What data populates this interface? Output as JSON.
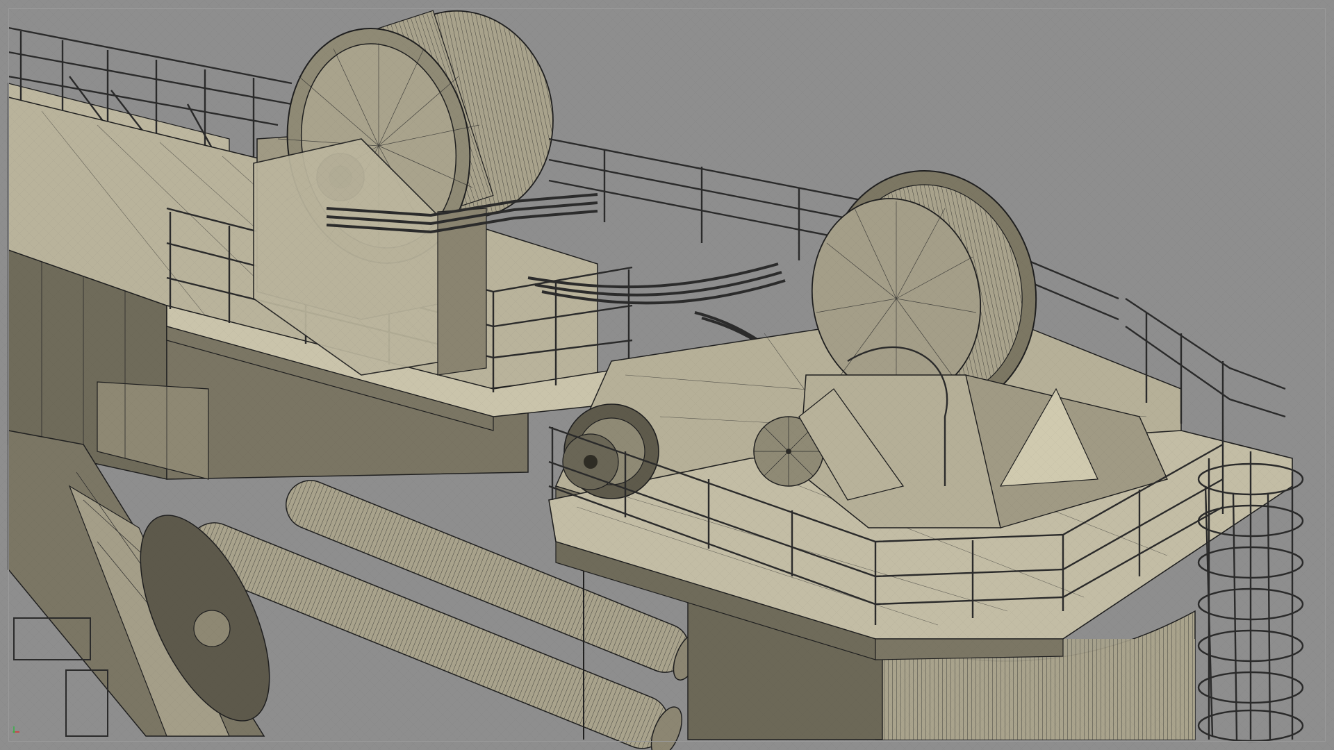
{
  "viewport": {
    "background": "#8e8e8e",
    "render_mode": "wireframe-on-shaded",
    "model_fill": "#aba58e",
    "model_fill_light": "#c3bda5",
    "model_fill_dark": "#6d6957",
    "wire_color": "#1f1f1f"
  },
  "scene": {
    "subject": "crane-boom-with-cable-drums",
    "parts": [
      "left-cable-drum",
      "right-cable-drum",
      "walkway-platform",
      "safety-railings",
      "hydraulic-cylinders",
      "spiral-ladder-cage",
      "pivot-pulleys",
      "cable-bundles"
    ]
  },
  "gizmo": {
    "x_color": "#d23a3a",
    "y_color": "#3ab04a"
  }
}
